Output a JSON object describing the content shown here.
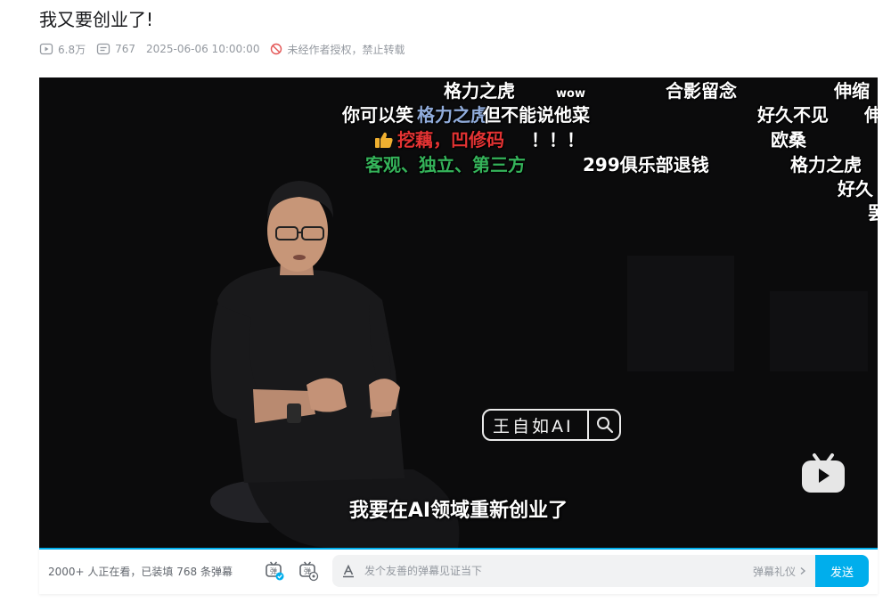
{
  "video": {
    "title": "我又要创业了!",
    "views": "6.8万",
    "danmaku_count": "767",
    "publish_time": "2025-06-06 10:00:00",
    "copyright_notice": "未经作者授权，禁止转载"
  },
  "danmaku": [
    {
      "text": "格力之虎",
      "style": ""
    },
    {
      "text": "wow",
      "style": "small"
    },
    {
      "text": "合影留念",
      "style": ""
    },
    {
      "text": "伸缩",
      "style": ""
    },
    {
      "text": "你可以笑",
      "style": ""
    },
    {
      "text": "格力之虎",
      "style": ""
    },
    {
      "text": "但不能说他菜",
      "style": ""
    },
    {
      "text": "好久不见",
      "style": ""
    },
    {
      "text": "伸",
      "style": ""
    },
    {
      "text": "挖藕，凹修码",
      "style": "red"
    },
    {
      "text": "！！！",
      "style": ""
    },
    {
      "text": "欧桑",
      "style": ""
    },
    {
      "text": "客观、独立、第三方",
      "style": "green"
    },
    {
      "text": "299俱乐部退钱",
      "style": ""
    },
    {
      "text": "格力之虎",
      "style": ""
    },
    {
      "text": "好久",
      "style": ""
    },
    {
      "text": "罢",
      "style": ""
    }
  ],
  "watermark": {
    "text": "王自如AI"
  },
  "subtitle": "我要在AI领域重新创业了",
  "controls": {
    "viewers_text": "2000+ 人正在看，已装填 768 条弹幕",
    "input_placeholder": "发个友善的弹幕见证当下",
    "etiquette_label": "弹幕礼仪",
    "send_label": "发送"
  },
  "colors": {
    "accent": "#00aeec",
    "meta_text": "#9499a0"
  },
  "icons": [
    "play-count-icon",
    "danmaku-count-icon",
    "no-repost-icon",
    "thumb-up-icon",
    "bilibili-tv-icon",
    "danmaku-toggle-icon",
    "danmaku-settings-icon",
    "text-format-icon",
    "chevron-right-icon",
    "search-icon"
  ]
}
